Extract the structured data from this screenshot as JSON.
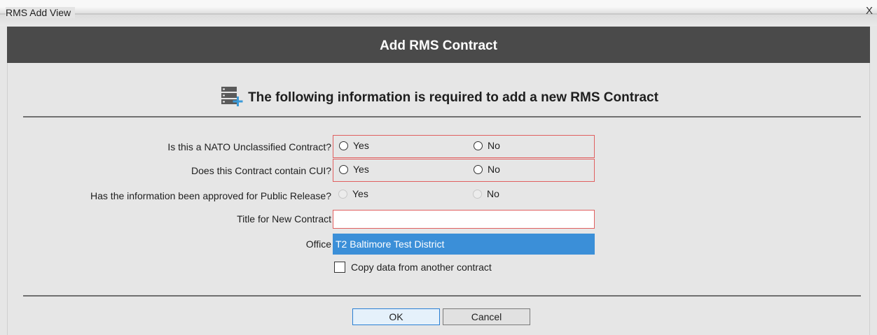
{
  "window": {
    "title": "RMS Add View",
    "close_glyph": "X",
    "close_icon": "close-icon"
  },
  "dialog": {
    "header": "Add RMS Contract",
    "subheader_icon": "server-add-icon",
    "subheader": "The following information is required to add a new RMS Contract"
  },
  "form": {
    "nato": {
      "label": "Is this a NATO Unclassified Contract?",
      "yes": "Yes",
      "no": "No",
      "selected": null,
      "required": true
    },
    "cui": {
      "label": "Does this Contract contain CUI?",
      "yes": "Yes",
      "no": "No",
      "selected": null,
      "required": true
    },
    "public_release": {
      "label": "Has the information been approved for Public Release?",
      "yes": "Yes",
      "no": "No",
      "selected": null,
      "disabled": true
    },
    "title": {
      "label": "Title for New Contract",
      "value": "",
      "required": true
    },
    "office": {
      "label": "Office",
      "value": "T2 Baltimore Test District"
    },
    "copy": {
      "label": "Copy data from another contract",
      "checked": false
    }
  },
  "buttons": {
    "ok": "OK",
    "cancel": "Cancel"
  },
  "colors": {
    "header_bg": "#4a4a4a",
    "body_bg": "#e6e6e6",
    "required_border": "#e06060",
    "selection_blue": "#3b8fd8",
    "ok_border": "#2a7fd4"
  }
}
